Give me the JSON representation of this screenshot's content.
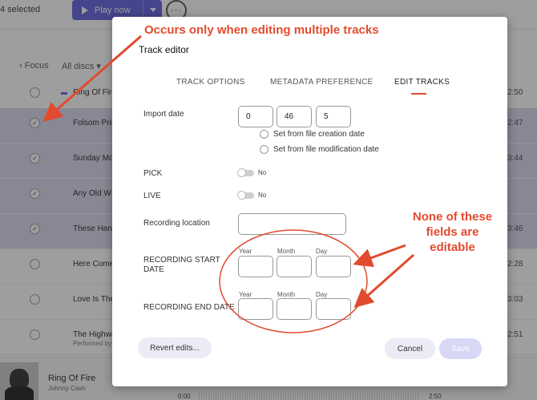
{
  "topbar": {
    "selected_count": "4 selected",
    "play_label": "Play now",
    "more_label": "···"
  },
  "filterbar": {
    "focus_label": "Focus",
    "discs_label": "All discs"
  },
  "tracks": [
    {
      "title": "Ring Of Fire",
      "subtitle": "",
      "duration": "2:50",
      "selected": false,
      "playing": true
    },
    {
      "title": "Folsom Pris",
      "subtitle": "",
      "duration": "2:47",
      "selected": true,
      "playing": false
    },
    {
      "title": "Sunday Mo",
      "subtitle": "",
      "duration": "3:44",
      "selected": true,
      "playing": false
    },
    {
      "title": "Any Old W",
      "subtitle": "",
      "duration": "",
      "selected": true,
      "playing": false
    },
    {
      "title": "These Hand",
      "subtitle": "",
      "duration": "3:46",
      "selected": true,
      "playing": false
    },
    {
      "title": "Here Come",
      "subtitle": "",
      "duration": "2:28",
      "selected": false,
      "playing": false
    },
    {
      "title": "Love Is The",
      "subtitle": "",
      "duration": "3:03",
      "selected": false,
      "playing": false
    },
    {
      "title": "The Highwa",
      "subtitle": "Performed by",
      "duration": "2:51",
      "selected": false,
      "playing": false
    }
  ],
  "player": {
    "title": "Ring Of Fire",
    "artist": "Johnny Cash",
    "time_start": "0:00",
    "time_end": "2:50"
  },
  "modal": {
    "title": "Track editor",
    "tabs": [
      {
        "label": "TRACK OPTIONS",
        "active": false
      },
      {
        "label": "METADATA PREFERENCE",
        "active": false
      },
      {
        "label": "EDIT TRACKS",
        "active": true
      }
    ],
    "import_date": {
      "label": "Import date",
      "values": [
        "0",
        "46",
        "5"
      ],
      "radio_creation": "Set from file creation date",
      "radio_modification": "Set from file modification date"
    },
    "pick": {
      "label": "PICK",
      "value": "No"
    },
    "live": {
      "label": "LIVE",
      "value": "No"
    },
    "recording_location": {
      "label": "Recording location",
      "value": ""
    },
    "recording_start": {
      "label": "RECORDING START DATE",
      "year_label": "Year",
      "month_label": "Month",
      "day_label": "Day"
    },
    "recording_end": {
      "label": "RECORDING END DATE",
      "year_label": "Year",
      "month_label": "Month",
      "day_label": "Day"
    },
    "buttons": {
      "revert": "Revert edits...",
      "cancel": "Cancel",
      "save": "Save"
    }
  },
  "annotations": {
    "top": "Occurs only when editing multiple tracks",
    "right": "None of these fields are editable",
    "color": "#e24b2d"
  },
  "colors": {
    "accent": "#5e5ee0",
    "selected_row": "#d8d7ee",
    "annotation": "#e24b2d"
  }
}
